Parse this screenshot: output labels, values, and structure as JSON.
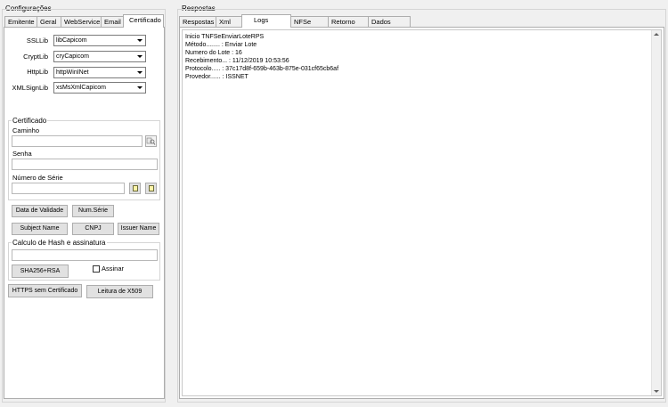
{
  "left": {
    "group_title": "Configurações",
    "tabs": [
      {
        "label": "Emitente"
      },
      {
        "label": "Geral"
      },
      {
        "label": "WebService"
      },
      {
        "label": "Email"
      },
      {
        "label": "Certificado"
      }
    ],
    "libs": {
      "ssl_label": "SSLLib",
      "ssl_value": "libCapicom",
      "crypt_label": "CryptLib",
      "crypt_value": "cryCapicom",
      "http_label": "HttpLib",
      "http_value": "httpWinINet",
      "xmlsign_label": "XMLSignLib",
      "xmlsign_value": "xsMsXmlCapicom"
    },
    "certificado": {
      "title": "Certificado",
      "caminho_label": "Caminho",
      "caminho_value": "",
      "senha_label": "Senha",
      "senha_value": "",
      "serie_label": "Número de Série",
      "serie_value": ""
    },
    "buttons": {
      "data_validade": "Data de Validade",
      "num_serie": "Num.Série",
      "subject_name": "Subject Name",
      "cnpj": "CNPJ",
      "issuer_name": "Issuer Name",
      "sha256": "SHA256+RSA",
      "https_sem_cert": "HTTPS sem Certificado",
      "leitura_x509": "Leitura de X509"
    },
    "hash": {
      "title": "Calculo de Hash e assinatura",
      "value": "",
      "assinar_label": "Assinar",
      "assinar_checked": false
    }
  },
  "right": {
    "group_title": "Respostas",
    "tabs": [
      {
        "label": "Respostas"
      },
      {
        "label": "Xml"
      },
      {
        "label": "Logs"
      },
      {
        "label": "NFSe"
      },
      {
        "label": "Retorno"
      },
      {
        "label": "Dados"
      }
    ],
    "active_tab": "Logs",
    "log_lines": [
      "Inicio TNFSeEnviarLoteRPS",
      "Método........ : Enviar Lote",
      "Numero do Lote : 16",
      "Recebimento... : 11/12/2019 10:53:56",
      "Protocolo..... : 37c17d8f-659b-463b-875e-031cf65cb6af",
      "Provedor...... : ISSNET"
    ]
  },
  "colors": {
    "window_bg": "#f0f0f0",
    "panel_bg": "#ffffff",
    "border": "#adadad"
  }
}
